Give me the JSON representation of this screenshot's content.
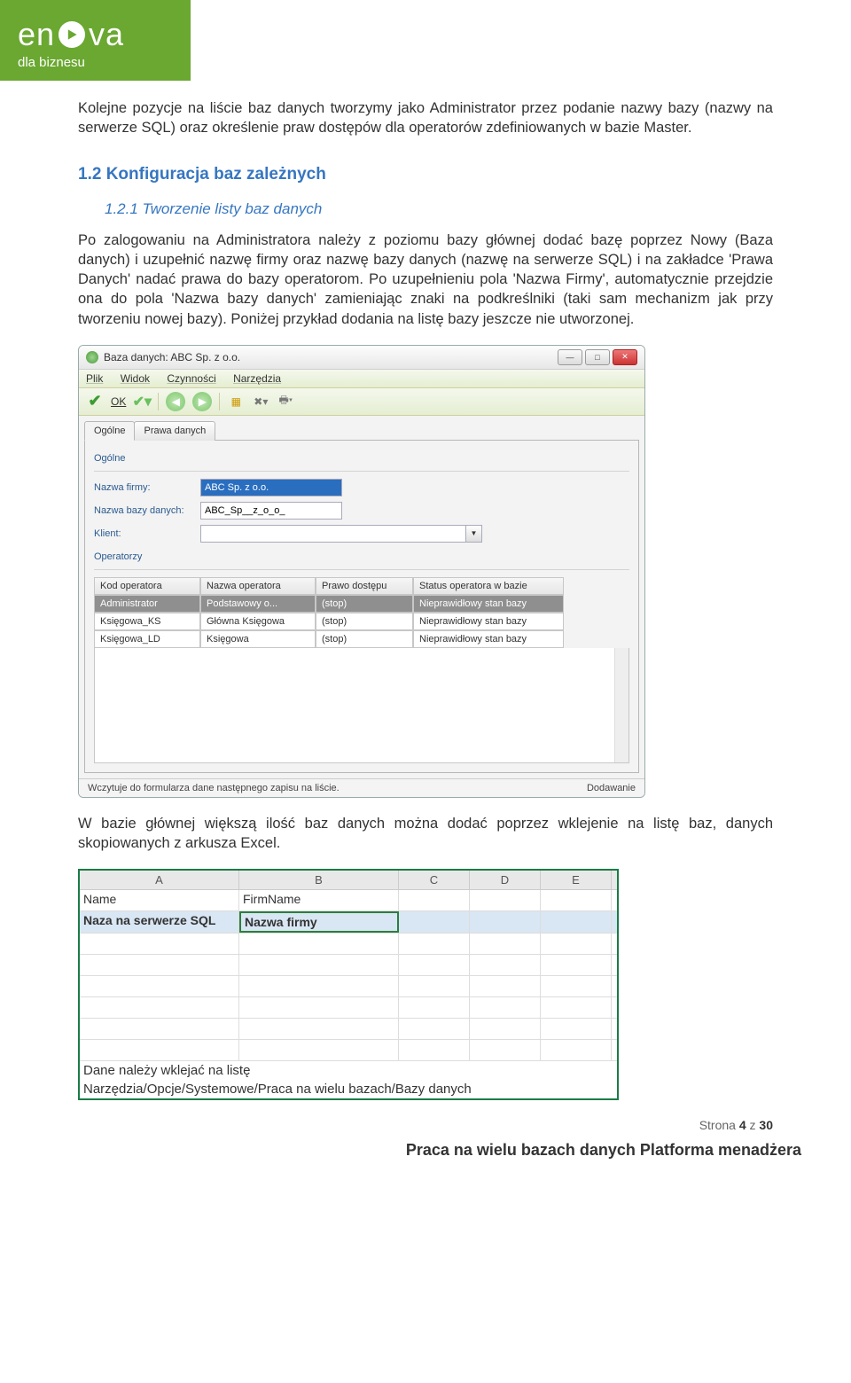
{
  "logo": {
    "text1": "en",
    "text2": "va",
    "sub": "dla biznesu"
  },
  "para1": "Kolejne pozycje na liście baz danych tworzymy jako Administrator przez podanie nazwy bazy (nazwy na serwerze SQL) oraz określenie praw dostępów dla operatorów zdefiniowanych w bazie Master.",
  "sec_h": "1.2   Konfiguracja baz zależnych",
  "sub_h": "1.2.1   Tworzenie listy baz danych",
  "para2": "Po zalogowaniu na Administratora należy  z poziomu bazy głównej dodać bazę poprzez Nowy (Baza danych) i uzupełnić nazwę firmy oraz nazwę bazy danych (nazwę na serwerze SQL) i na zakładce 'Prawa Danych' nadać prawa do bazy operatorom. Po uzupełnieniu pola 'Nazwa Firmy',   automatycznie przejdzie ona do pola 'Nazwa bazy danych' zamieniając znaki na podkreślniki (taki sam mechanizm jak przy tworzeniu nowej bazy). Poniżej przykład dodania na listę bazy jeszcze nie utworzonej.",
  "app": {
    "title": "Baza danych: ABC Sp. z o.o.",
    "menu": [
      "Plik",
      "Widok",
      "Czynności",
      "Narzędzia"
    ],
    "ok_label": "OK",
    "tabs": [
      "Ogólne",
      "Prawa danych"
    ],
    "group1": "Ogólne",
    "fields": {
      "firm_label": "Nazwa firmy:",
      "firm_value": "ABC Sp. z o.o.",
      "db_label": "Nazwa bazy danych:",
      "db_value": "ABC_Sp__z_o_o_",
      "client_label": "Klient:",
      "client_value": ""
    },
    "group2": "Operatorzy",
    "grid": {
      "headers": [
        "Kod operatora",
        "Nazwa operatora",
        "Prawo dostępu",
        "Status operatora w bazie"
      ],
      "rows": [
        [
          "Administrator",
          "Podstawowy o...",
          "(stop)",
          "Nieprawidłowy stan bazy"
        ],
        [
          "Księgowa_KS",
          "Główna Księgowa",
          "(stop)",
          "Nieprawidłowy stan bazy"
        ],
        [
          "Księgowa_LD",
          "Księgowa",
          "(stop)",
          "Nieprawidłowy stan bazy"
        ]
      ]
    },
    "status_left": "Wczytuje do formularza dane następnego zapisu na liście.",
    "status_right": "Dodawanie"
  },
  "para3": " W bazie głównej większą ilość baz danych można dodać poprzez wklejenie na listę baz, danych skopiowanych z arkusza Excel.",
  "excel": {
    "headers": [
      "A",
      "B",
      "C",
      "D",
      "E"
    ],
    "rows": [
      [
        "Name",
        "FirmName",
        "",
        "",
        ""
      ],
      [
        "Naza na serwerze SQL",
        "Nazwa firmy",
        "",
        "",
        ""
      ]
    ],
    "foot1": "Dane należy wklejać na listę",
    "foot2": "Narzędzia/Opcje/Systemowe/Praca na wielu bazach/Bazy danych"
  },
  "footer": {
    "page_label": "Strona",
    "page_cur": "4",
    "page_sep": "z",
    "page_total": "30",
    "doc_title": "Praca na wielu bazach danych Platforma menadżera"
  }
}
